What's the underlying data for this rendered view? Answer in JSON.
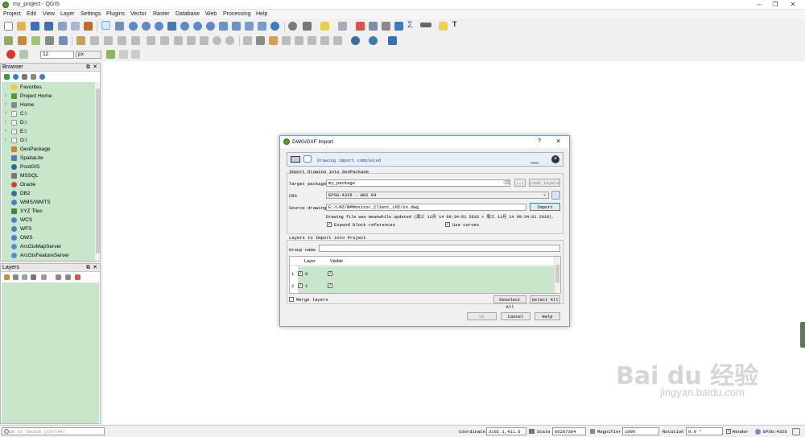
{
  "window": {
    "title": "my_project - QGIS"
  },
  "menu": [
    "Project",
    "Edit",
    "View",
    "Layer",
    "Settings",
    "Plugins",
    "Vector",
    "Raster",
    "Database",
    "Web",
    "Processing",
    "Help"
  ],
  "toolbar": {
    "scale_value": "12",
    "unit": "px"
  },
  "browser": {
    "title": "Browser",
    "items": [
      {
        "label": "Favorites",
        "icon": "star-icon",
        "arrow": ""
      },
      {
        "label": "Project Home",
        "icon": "project-home-icon",
        "arrow": "›"
      },
      {
        "label": "Home",
        "icon": "home-icon",
        "arrow": "›"
      },
      {
        "label": "C:\\",
        "icon": "folder-icon",
        "arrow": "›"
      },
      {
        "label": "D:\\",
        "icon": "folder-icon",
        "arrow": "›"
      },
      {
        "label": "E:\\",
        "icon": "folder-icon",
        "arrow": "›"
      },
      {
        "label": "G:\\",
        "icon": "folder-icon",
        "arrow": "›"
      },
      {
        "label": "GeoPackage",
        "icon": "geopackage-icon",
        "arrow": ""
      },
      {
        "label": "SpatiaLite",
        "icon": "spatialite-icon",
        "arrow": ""
      },
      {
        "label": "PostGIS",
        "icon": "postgis-icon",
        "arrow": ""
      },
      {
        "label": "MSSQL",
        "icon": "mssql-icon",
        "arrow": ""
      },
      {
        "label": "Oracle",
        "icon": "oracle-icon",
        "arrow": ""
      },
      {
        "label": "DB2",
        "icon": "db2-icon",
        "arrow": ""
      },
      {
        "label": "WMS/WMTS",
        "icon": "wms-icon",
        "arrow": ""
      },
      {
        "label": "XYZ Tiles",
        "icon": "xyz-icon",
        "arrow": ""
      },
      {
        "label": "WCS",
        "icon": "wcs-icon",
        "arrow": ""
      },
      {
        "label": "WFS",
        "icon": "wfs-icon",
        "arrow": ""
      },
      {
        "label": "OWS",
        "icon": "ows-icon",
        "arrow": ""
      },
      {
        "label": "ArcGisMapServer",
        "icon": "arcgis-map-icon",
        "arrow": ""
      },
      {
        "label": "ArcGisFeatureServer",
        "icon": "arcgis-feature-icon",
        "arrow": ""
      }
    ]
  },
  "layers": {
    "title": "Layers"
  },
  "status": {
    "locate_placeholder": "Type to locate (Ctrl+K)",
    "coordinate_label": "Coordinate",
    "coordinate_value": "3192.1,411.6",
    "scale_label": "Scale",
    "scale_value": "66287384",
    "magnifier_label": "Magnifier",
    "magnifier_value": "100%",
    "rotation_label": "Rotation",
    "rotation_value": "0.0 °",
    "render_label": "Render",
    "crs_label": "EPSG:4326"
  },
  "dialog": {
    "title": "DWG/DXF Import",
    "help": "?",
    "close": "×",
    "message": "Drawing import completed",
    "section_import": "Import Drawing into GeoPackage",
    "target_label": "Target package",
    "target_value": "my_package",
    "browse_label": "...",
    "load_layers_label": "Load layers",
    "crs_label": "CRS",
    "crs_value": "EPSG:4326 - WGS 84",
    "source_label": "Source drawing",
    "source_value": "E:/LMZ/BMMonitor_Client_LMZ/xx.dwg",
    "import_label": "Import",
    "modified_note": "Drawing file was meanwhile updated (周三 11月 14 09:34:01 2018 > 周三 11月 14 09:34:01 2018).",
    "expand_label": "Expand block references",
    "curves_label": "Use curves",
    "section_layers": "Layers to Import into Project",
    "group_label": "Group name",
    "table_headers": [
      "Layer",
      "Visible"
    ],
    "rows": [
      {
        "num": "1",
        "layer": "0"
      },
      {
        "num": "2",
        "layer": "1"
      }
    ],
    "merge_label": "Merge layers",
    "deselect_label": "Deselect All",
    "select_label": "Select All",
    "ok_label": "OK",
    "cancel_label": "Cancel",
    "helpbtn_label": "Help"
  },
  "watermark": {
    "brand": "Bai du 经验",
    "url": "jingyan.baidu.com"
  }
}
